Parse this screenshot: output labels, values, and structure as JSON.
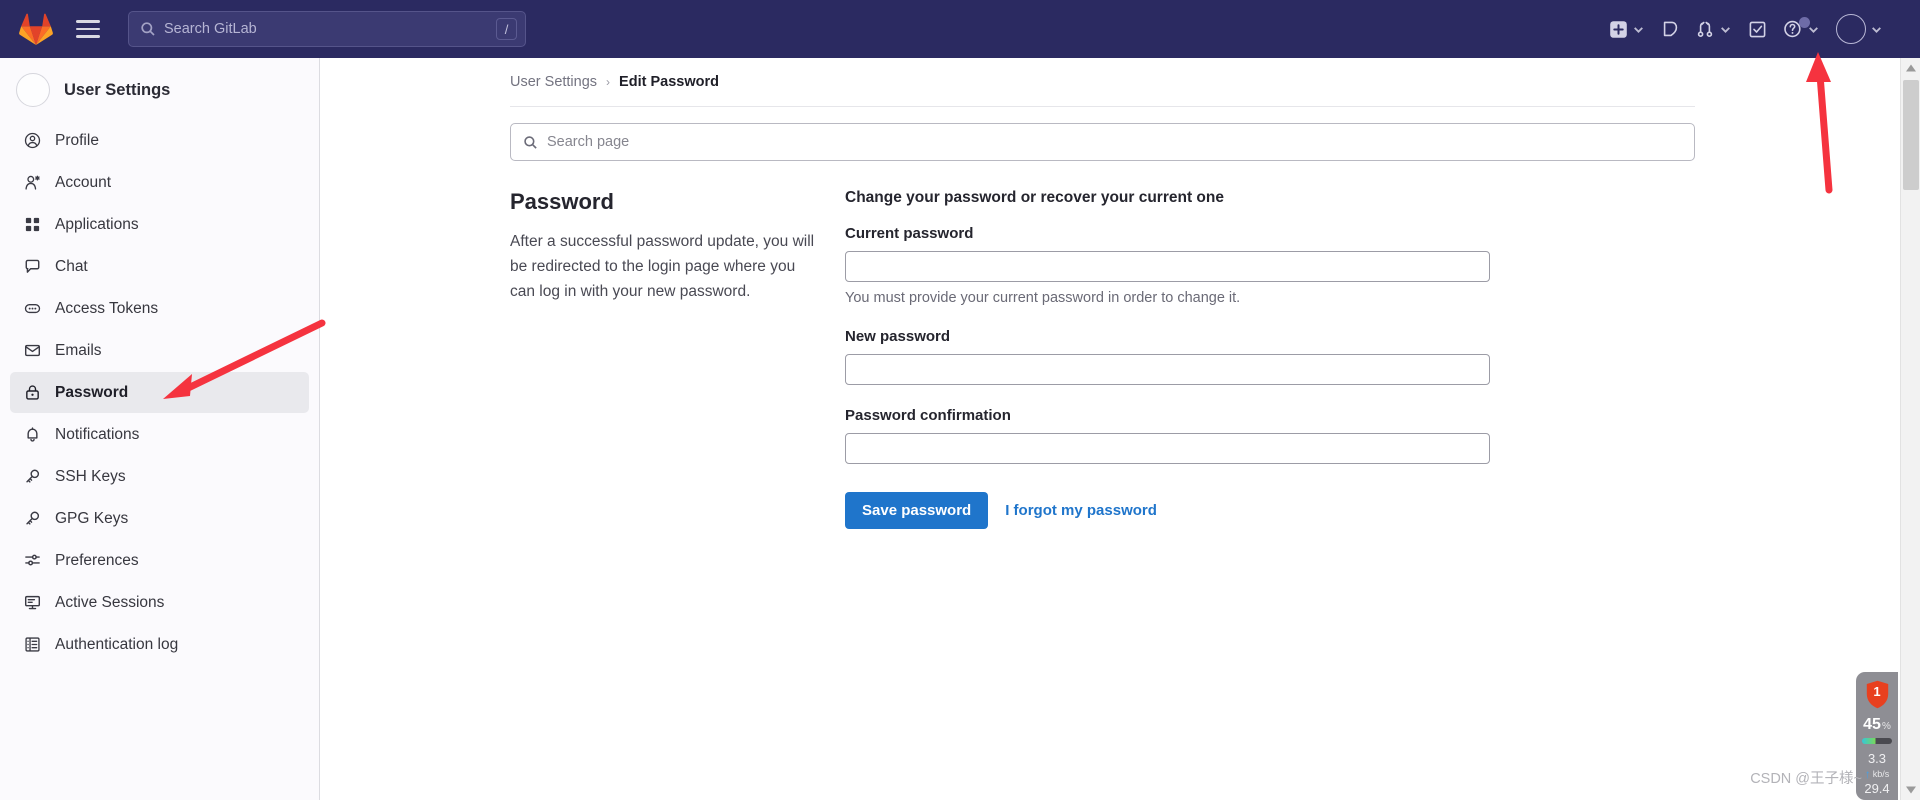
{
  "navbar": {
    "logo_icon": "gitlab-logo-icon",
    "menu_icon": "hamburger-menu-icon",
    "search": {
      "placeholder": "Search GitLab",
      "value": "",
      "shortcut": "/"
    },
    "right_items": [
      {
        "name": "create-new-menu",
        "icon": "plus-square-icon",
        "has_chevron": true
      },
      {
        "name": "issues-link",
        "icon": "issues-icon",
        "has_chevron": false
      },
      {
        "name": "merge-requests-menu",
        "icon": "merge-request-icon",
        "has_chevron": true
      },
      {
        "name": "todos-link",
        "icon": "todo-checkbox-icon",
        "has_chevron": false
      },
      {
        "name": "help-menu",
        "icon": "question-circle-icon",
        "has_chevron": true
      },
      {
        "name": "user-menu",
        "icon": "avatar-icon",
        "has_chevron": true
      }
    ]
  },
  "sidebar": {
    "title": "User Settings",
    "items": [
      {
        "label": "Profile",
        "icon": "user-circle-icon",
        "active": false
      },
      {
        "label": "Account",
        "icon": "account-user-icon",
        "active": false
      },
      {
        "label": "Applications",
        "icon": "applications-grid-icon",
        "active": false
      },
      {
        "label": "Chat",
        "icon": "chat-bubble-icon",
        "active": false
      },
      {
        "label": "Access Tokens",
        "icon": "token-icon",
        "active": false
      },
      {
        "label": "Emails",
        "icon": "envelope-icon",
        "active": false
      },
      {
        "label": "Password",
        "icon": "lock-icon",
        "active": true
      },
      {
        "label": "Notifications",
        "icon": "bell-icon",
        "active": false
      },
      {
        "label": "SSH Keys",
        "icon": "key-icon",
        "active": false
      },
      {
        "label": "GPG Keys",
        "icon": "key-icon",
        "active": false
      },
      {
        "label": "Preferences",
        "icon": "sliders-icon",
        "active": false
      },
      {
        "label": "Active Sessions",
        "icon": "monitor-icon",
        "active": false
      },
      {
        "label": "Authentication log",
        "icon": "list-table-icon",
        "active": false
      }
    ]
  },
  "breadcrumb": {
    "parent": "User Settings",
    "separator": "›",
    "current": "Edit Password"
  },
  "page_search": {
    "placeholder": "Search page",
    "value": "",
    "icon": "search-icon"
  },
  "main": {
    "section_title": "Password",
    "section_description": "After a successful password update, you will be redirected to the login page where you can log in with your new password.",
    "form_heading": "Change your password or recover your current one",
    "fields": [
      {
        "label": "Current password",
        "value": "",
        "help": "You must provide your current password in order to change it."
      },
      {
        "label": "New password",
        "value": "",
        "help": ""
      },
      {
        "label": "Password confirmation",
        "value": "",
        "help": ""
      }
    ],
    "save_label": "Save password",
    "forgot_label": "I forgot my password"
  },
  "widget": {
    "badge_count": "1",
    "percent": "45",
    "percent_symbol": "%",
    "stat_upload": "3.3",
    "unit": "kb/s",
    "stat_download": "29.4"
  },
  "watermark": "CSDN @王子様~",
  "colors": {
    "navbar_bg": "#2b2a61",
    "accent_blue": "#1f75cb",
    "sidebar_active_bg": "#e9e9ed",
    "annotation_red": "#f5333f",
    "badge_red": "#e8401f"
  }
}
